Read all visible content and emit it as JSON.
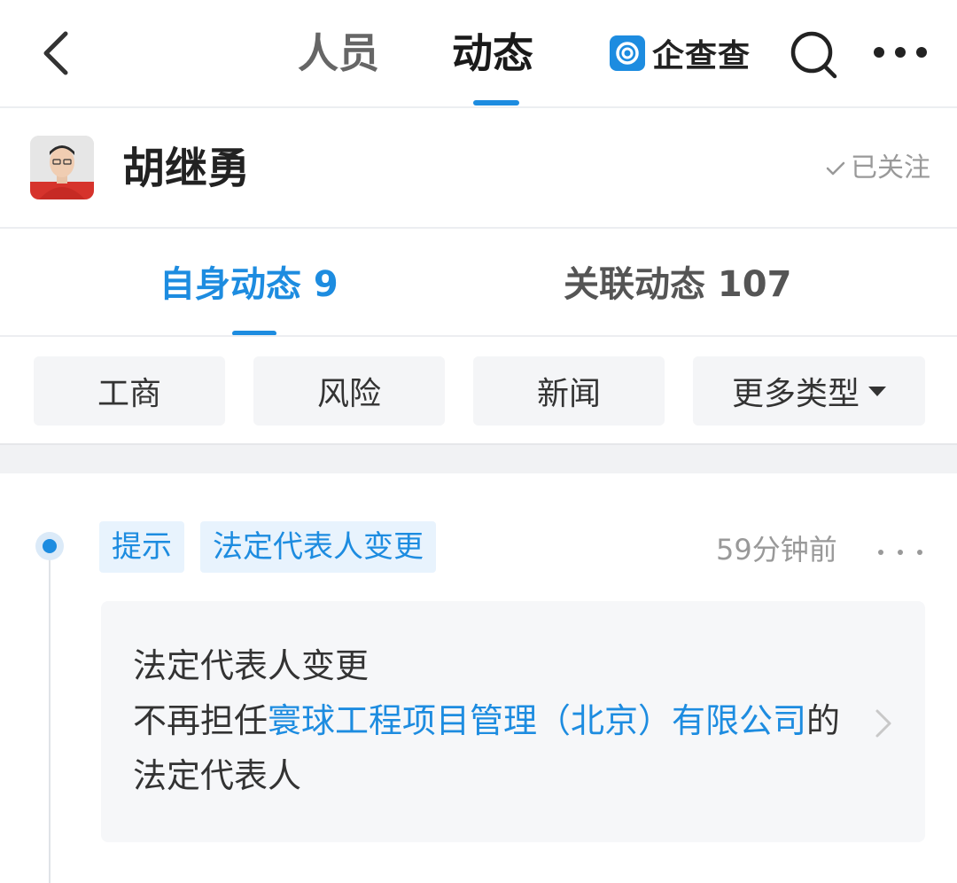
{
  "top_nav": {
    "tabs": [
      {
        "label": "人员",
        "active": false
      },
      {
        "label": "动态",
        "active": true
      }
    ],
    "brand": "企查查",
    "accent_color": "#1d8ce0",
    "icons": [
      "back-arrow-icon",
      "qcc-logo-icon",
      "search-icon",
      "more-dots-icon"
    ]
  },
  "person": {
    "name": "胡继勇",
    "follow_status": "已关注"
  },
  "sub_tabs": [
    {
      "label": "自身动态 9",
      "active": true
    },
    {
      "label": "关联动态 107",
      "active": false
    }
  ],
  "filters": [
    "工商",
    "风险",
    "新闻",
    "更多类型"
  ],
  "feed": [
    {
      "tags": [
        "提示",
        "法定代表人变更"
      ],
      "time": "59分钟前",
      "title": "法定代表人变更",
      "line_prefix": "不再担任",
      "company_link": "寰球工程项目管理（北京）有限公司",
      "line_suffix": "的法定代表人"
    }
  ]
}
